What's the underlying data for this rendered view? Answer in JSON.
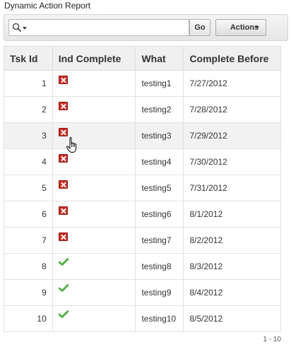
{
  "region": {
    "title": "Dynamic Action Report"
  },
  "search": {
    "value": "",
    "go_label": "Go",
    "actions_label": "Actions"
  },
  "table": {
    "headers": {
      "tsk_id": "Tsk Id",
      "ind_complete": "Ind Complete",
      "what": "What",
      "complete_before": "Complete Before"
    },
    "rows": [
      {
        "tsk_id": "1",
        "complete": false,
        "what": "testing1",
        "complete_before": "7/27/2012"
      },
      {
        "tsk_id": "2",
        "complete": false,
        "what": "testing2",
        "complete_before": "7/28/2012"
      },
      {
        "tsk_id": "3",
        "complete": false,
        "what": "testing3",
        "complete_before": "7/29/2012"
      },
      {
        "tsk_id": "4",
        "complete": false,
        "what": "testing4",
        "complete_before": "7/30/2012"
      },
      {
        "tsk_id": "5",
        "complete": false,
        "what": "testing5",
        "complete_before": "7/31/2012"
      },
      {
        "tsk_id": "6",
        "complete": false,
        "what": "testing6",
        "complete_before": "8/1/2012"
      },
      {
        "tsk_id": "7",
        "complete": false,
        "what": "testing7",
        "complete_before": "8/2/2012"
      },
      {
        "tsk_id": "8",
        "complete": true,
        "what": "testing8",
        "complete_before": "8/3/2012"
      },
      {
        "tsk_id": "9",
        "complete": true,
        "what": "testing9",
        "complete_before": "8/4/2012"
      },
      {
        "tsk_id": "10",
        "complete": true,
        "what": "testing10",
        "complete_before": "8/5/2012"
      }
    ]
  },
  "pagination": {
    "range": "1 - 10"
  },
  "icons": {
    "incomplete": "red-x-icon",
    "complete": "green-check-icon",
    "search": "magnifier-icon",
    "pointer": "hand-pointer-icon"
  },
  "colors": {
    "incomplete": "#cc2b22",
    "complete": "#4caf3a",
    "hover_row": "#f2f2f2"
  }
}
